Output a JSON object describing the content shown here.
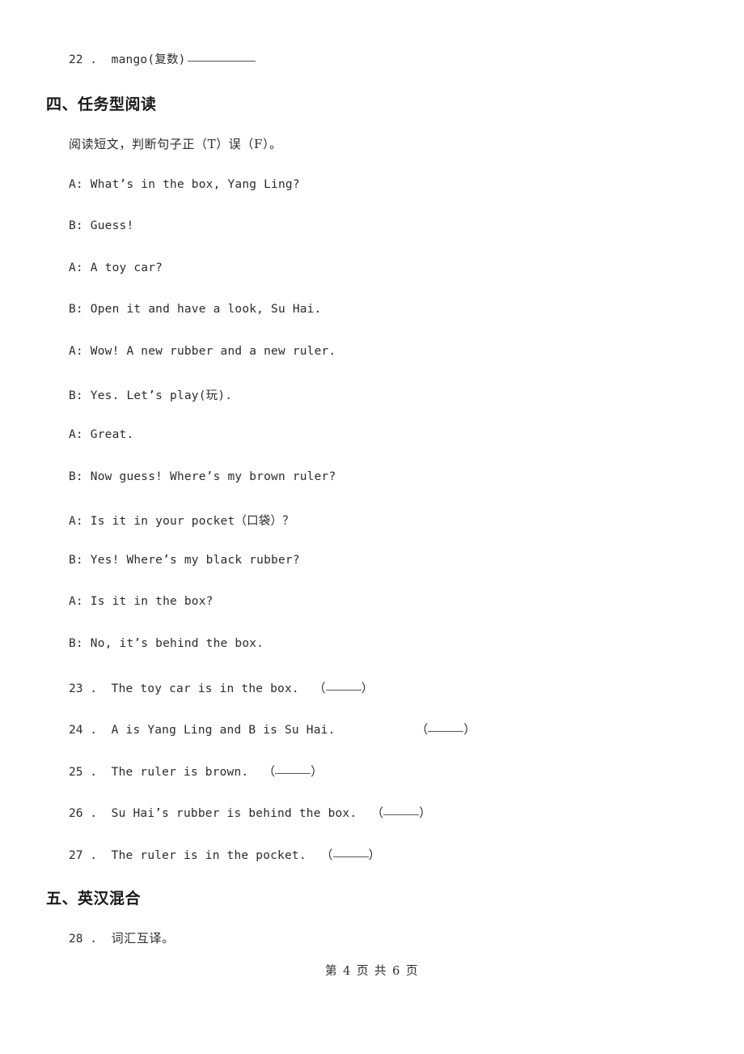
{
  "document": {
    "item22": {
      "number": "22 .",
      "text": "mango(复数)"
    },
    "section4": {
      "heading": "四、任务型阅读",
      "instruction": "阅读短文，判断句子正（T）误（F）。",
      "dialogue": [
        "A: What’s in the box, Yang Ling?",
        "B: Guess!",
        "A: A toy car?",
        "B: Open it and have a look, Su Hai.",
        "A: Wow! A new rubber and a new ruler.",
        "B: Yes. Let’s play(玩).",
        "A: Great.",
        "B: Now guess! Where’s my brown ruler?",
        "A: Is it in your pocket（口袋）？",
        "B: Yes! Where’s my black rubber?",
        "A: Is it in the box?",
        "B: No, it’s behind the box."
      ],
      "questions": [
        {
          "number": "23 .",
          "text": "The toy car is in the box.",
          "wide_gap": false
        },
        {
          "number": "24 .",
          "text": "A is Yang Ling and B is Su Hai.",
          "wide_gap": true
        },
        {
          "number": "25 .",
          "text": "The ruler is brown.",
          "wide_gap": false
        },
        {
          "number": "26 .",
          "text": "Su Hai’s rubber is behind the box.",
          "wide_gap": false
        },
        {
          "number": "27 .",
          "text": "The ruler is in the pocket.",
          "wide_gap": false
        }
      ],
      "paren_open": "（",
      "paren_close": "）"
    },
    "section5": {
      "heading": "五、英汉混合",
      "item28": {
        "number": "28 .",
        "text": "词汇互译。"
      }
    },
    "footer": {
      "text": "第 4 页 共 6 页"
    }
  }
}
